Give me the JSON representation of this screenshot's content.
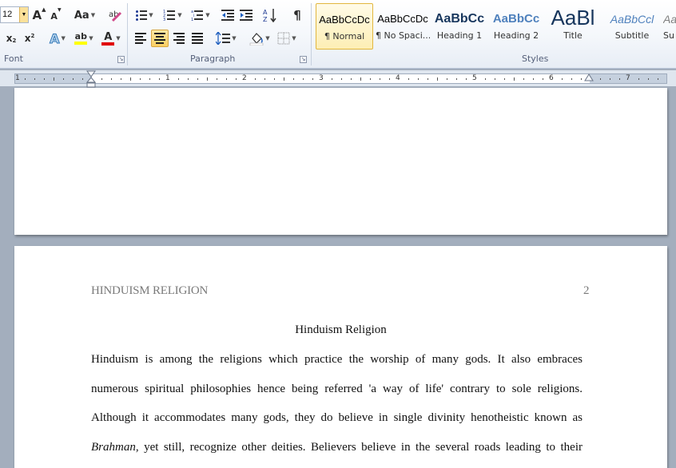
{
  "ribbon": {
    "font_size": "12",
    "groups": {
      "font_label": "Font",
      "paragraph_label": "Paragraph",
      "styles_label": "Styles"
    },
    "font_buttons": {
      "grow": "A",
      "shrink": "A",
      "change_case": "Aa",
      "subscript": "x",
      "superscript": "x",
      "text_effects": "A",
      "highlight": "ab",
      "font_color": "A"
    },
    "pilcrow": "¶",
    "sort": "A↓Z",
    "styles": [
      {
        "preview": "AaBbCcDc",
        "name": "¶ Normal",
        "color": "#000000"
      },
      {
        "preview": "AaBbCcDc",
        "name": "¶ No Spaci...",
        "color": "#000000"
      },
      {
        "preview": "AaBbCc",
        "name": "Heading 1",
        "color": "#17365d"
      },
      {
        "preview": "AaBbCc",
        "name": "Heading 2",
        "color": "#4f81bd"
      },
      {
        "preview": "AaBl",
        "name": "Title",
        "color": "#17365d"
      },
      {
        "preview": "AaBbCcl",
        "name": "Subtitle",
        "color": "#4f81bd"
      },
      {
        "preview": "Aa",
        "name": "Su",
        "color": "#7f7f7f"
      }
    ]
  },
  "ruler": {
    "numbers": [
      "1",
      "1",
      "2",
      "3",
      "4",
      "5",
      "6",
      "7"
    ]
  },
  "document": {
    "header": "HINDUISM RELIGION",
    "page_number": "2",
    "title": "Hinduism Religion",
    "lines": [
      "Hinduism is among the religions which practice the worship of many gods. It also embraces",
      "numerous spiritual philosophies hence being referred 'a way of life' contrary to sole religions.",
      "Although it accommodates many gods, they do believe in single divinity henotheistic known as",
      "yet still, recognize other deities. Believers believe in the several roads leading to their"
    ],
    "italic_word": "Brahman"
  },
  "colors": {
    "ribbon_bg": "#f4f7fb",
    "canvas_bg": "#a3aebd",
    "selected_style": "#fdeeb4",
    "header_text": "#7a7a7a"
  }
}
